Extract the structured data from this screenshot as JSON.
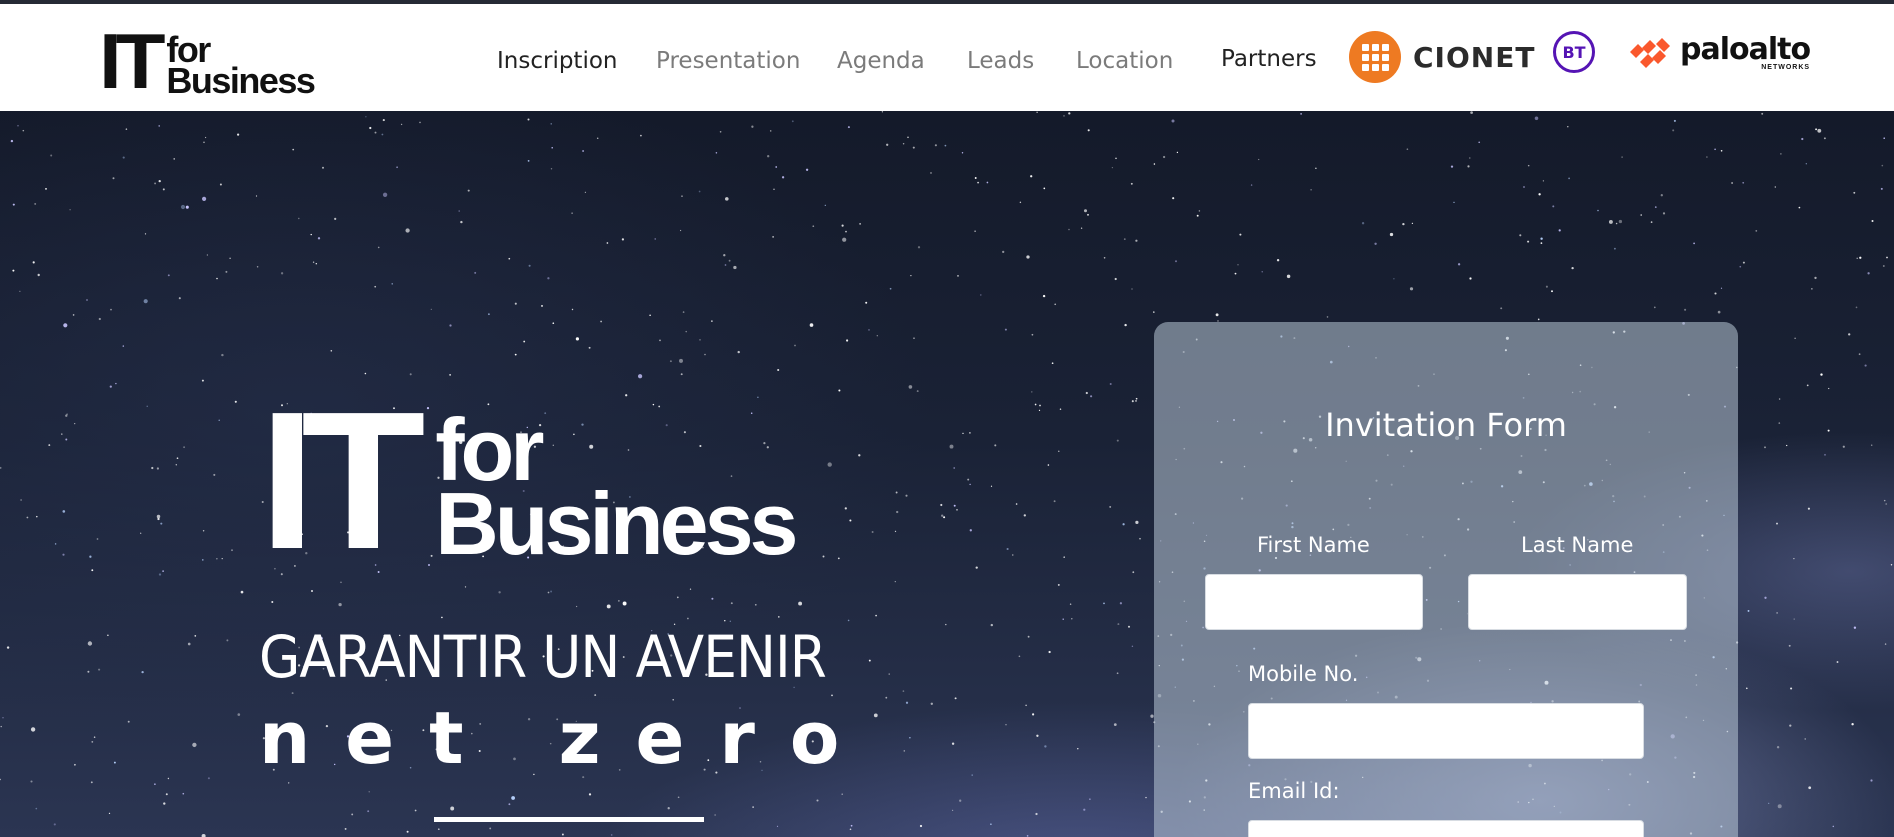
{
  "brand": {
    "logo_it": "IT",
    "logo_for": "for",
    "logo_business": "Business"
  },
  "nav": {
    "items": [
      {
        "label": "Inscription",
        "active": true
      },
      {
        "label": "Presentation",
        "active": false
      },
      {
        "label": "Agenda",
        "active": false
      },
      {
        "label": "Leads",
        "active": false
      },
      {
        "label": "Location",
        "active": false
      },
      {
        "label": "Partners",
        "active": true
      }
    ]
  },
  "partners": {
    "cionet": "CIONET",
    "bt": "BT",
    "paloalto": "paloalto",
    "paloalto_sub": "NETWORKS",
    "colors": {
      "cionet": "#ee7a22",
      "bt": "#5514b4",
      "paloalto": "#fa582d"
    }
  },
  "hero": {
    "logo_it": "IT",
    "logo_for": "for",
    "logo_business": "Business",
    "tagline": "GARANTIR UN AVENIR",
    "highlight": "net zero"
  },
  "form": {
    "title": "Invitation Form",
    "first_name_label": "First Name",
    "last_name_label": "Last Name",
    "mobile_label": "Mobile No.",
    "email_label": "Email Id:",
    "first_name_value": "",
    "last_name_value": "",
    "mobile_value": "",
    "email_value": ""
  }
}
